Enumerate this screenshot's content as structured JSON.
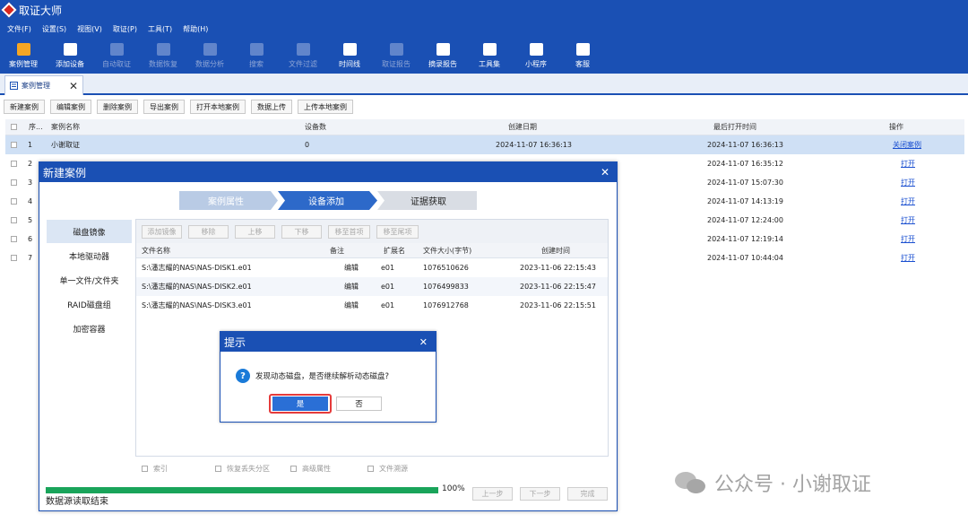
{
  "app": {
    "title": "取证大师"
  },
  "menu": [
    "文件(F)",
    "设置(S)",
    "视图(V)",
    "取证(P)",
    "工具(T)",
    "帮助(H)"
  ],
  "toolbar": [
    {
      "label": "案例管理",
      "icon": "case-management-icon",
      "color": "#f5a623",
      "enabled": true
    },
    {
      "label": "添加设备",
      "icon": "add-device-icon",
      "color": "#ffffff",
      "enabled": true
    },
    {
      "label": "自动取证",
      "icon": "auto-forensics-icon",
      "color": "#b9c6e6",
      "enabled": false
    },
    {
      "label": "数据恢复",
      "icon": "data-recovery-icon",
      "color": "#b9c6e6",
      "enabled": false
    },
    {
      "label": "数据分析",
      "icon": "data-analysis-icon",
      "color": "#b9c6e6",
      "enabled": false
    },
    {
      "label": "搜索",
      "icon": "search-icon",
      "color": "#b9c6e6",
      "enabled": false
    },
    {
      "label": "文件过滤",
      "icon": "file-filter-icon",
      "color": "#b9c6e6",
      "enabled": false
    },
    {
      "label": "时间线",
      "icon": "timeline-icon",
      "color": "#ffffff",
      "enabled": true
    },
    {
      "label": "取证报告",
      "icon": "forensic-report-icon",
      "color": "#b9c6e6",
      "enabled": false
    },
    {
      "label": "摘录报告",
      "icon": "excerpt-report-icon",
      "color": "#ffffff",
      "enabled": true
    },
    {
      "label": "工具集",
      "icon": "toolkit-icon",
      "color": "#ffffff",
      "enabled": true
    },
    {
      "label": "小程序",
      "icon": "mini-program-icon",
      "color": "#ffffff",
      "enabled": true
    },
    {
      "label": "客服",
      "icon": "customer-service-icon",
      "color": "#ffffff",
      "enabled": true
    }
  ],
  "tab": {
    "label": "案例管理"
  },
  "actions": [
    "新建案例",
    "编辑案例",
    "删除案例",
    "导出案例",
    "打开本地案例",
    "数据上传",
    "上传本地案例"
  ],
  "table": {
    "headers": [
      "序...",
      "案例名称",
      "设备数",
      "创建日期",
      "最后打开时间",
      "操作"
    ],
    "rows": [
      {
        "no": "1",
        "name": "小谢取证",
        "devices": "0",
        "created": "2024-11-07 16:36:13",
        "last": "2024-11-07 16:36:13",
        "op": "关闭案例",
        "selected": true
      },
      {
        "no": "2",
        "name": "",
        "devices": "",
        "created": "",
        "last": "2024-11-07 16:35:12",
        "op": "打开",
        "selected": false
      },
      {
        "no": "3",
        "name": "",
        "devices": "",
        "created": "",
        "last": "2024-11-07 15:07:30",
        "op": "打开",
        "selected": false
      },
      {
        "no": "4",
        "name": "",
        "devices": "",
        "created": "",
        "last": "2024-11-07 14:13:19",
        "op": "打开",
        "selected": false
      },
      {
        "no": "5",
        "name": "",
        "devices": "",
        "created": "",
        "last": "2024-11-07 12:24:00",
        "op": "打开",
        "selected": false
      },
      {
        "no": "6",
        "name": "",
        "devices": "",
        "created": "",
        "last": "2024-11-07 12:19:14",
        "op": "打开",
        "selected": false
      },
      {
        "no": "7",
        "name": "",
        "devices": "",
        "created": "",
        "last": "2024-11-07 10:44:04",
        "op": "打开",
        "selected": false
      }
    ]
  },
  "dialog": {
    "title": "新建案例",
    "steps": [
      "案例属性",
      "设备添加",
      "证据获取"
    ],
    "active_step": 1,
    "left_items": [
      "磁盘镜像",
      "本地驱动器",
      "单一文件/文件夹",
      "RAID磁盘组",
      "加密容器"
    ],
    "active_left": 0,
    "file_buttons": [
      "添加镜像",
      "移除",
      "上移",
      "下移",
      "移至首项",
      "移至尾项"
    ],
    "file_headers": [
      "文件名称",
      "备注",
      "扩展名",
      "文件大小(字节)",
      "创建时间"
    ],
    "files": [
      {
        "name": "S:\\潘志耀的NAS\\NAS-DISK1.e01",
        "note": "编辑",
        "ext": "e01",
        "size": "1076510626",
        "time": "2023-11-06 22:15:43"
      },
      {
        "name": "S:\\潘志耀的NAS\\NAS-DISK2.e01",
        "note": "编辑",
        "ext": "e01",
        "size": "1076499833",
        "time": "2023-11-06 22:15:47"
      },
      {
        "name": "S:\\潘志耀的NAS\\NAS-DISK3.e01",
        "note": "编辑",
        "ext": "e01",
        "size": "1076912768",
        "time": "2023-11-06 22:15:51"
      }
    ],
    "options": [
      "索引",
      "恢复丢失分区",
      "高级属性",
      "文件溯源"
    ],
    "progress": 1.0,
    "progress_text": "100%",
    "status": "数据源读取结束",
    "nav": [
      "上一步",
      "下一步",
      "完成"
    ]
  },
  "prompt": {
    "title": "提示",
    "message": "发现动态磁盘，是否继续解析动态磁盘?",
    "yes": "是",
    "no": "否"
  },
  "watermark": "公众号 · 小谢取证",
  "colors": {
    "accent": "#1a50b4",
    "progress": "#19a45a",
    "highlight": "#e53b3b",
    "link": "#1a4fd0"
  }
}
